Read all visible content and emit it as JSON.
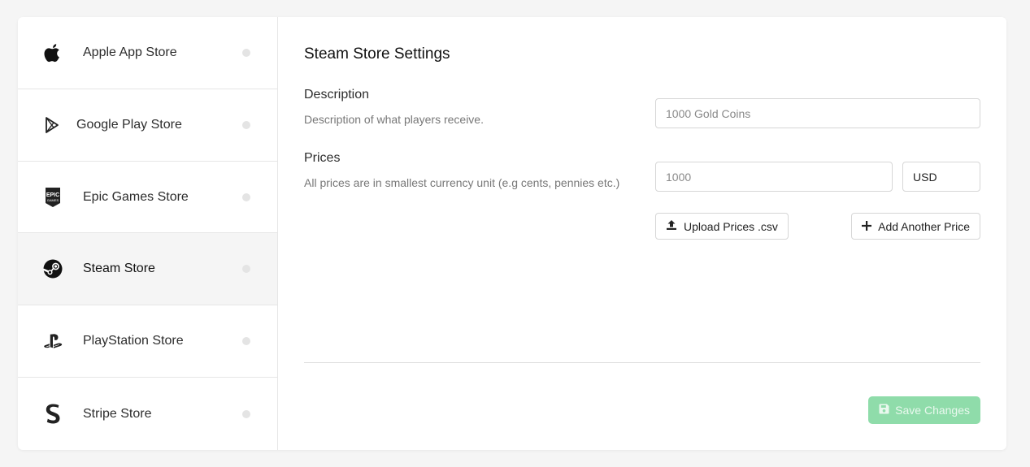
{
  "sidebar": {
    "items": [
      {
        "label": "Apple App Store",
        "icon": "apple-icon"
      },
      {
        "label": "Google Play Store",
        "icon": "google-play-icon"
      },
      {
        "label": "Epic Games Store",
        "icon": "epic-games-icon"
      },
      {
        "label": "Steam Store",
        "icon": "steam-icon",
        "active": true
      },
      {
        "label": "PlayStation Store",
        "icon": "playstation-icon"
      },
      {
        "label": "Stripe Store",
        "icon": "stripe-icon"
      }
    ]
  },
  "main": {
    "title": "Steam Store Settings",
    "description": {
      "title": "Description",
      "help": "Description of what players receive.",
      "placeholder": "1000 Gold Coins"
    },
    "prices": {
      "title": "Prices",
      "help": "All prices are in smallest currency unit (e.g cents, pennies etc.)",
      "amount_placeholder": "1000",
      "currency": "USD",
      "upload_label": "Upload Prices .csv",
      "add_label": "Add Another Price"
    },
    "save_label": "Save Changes"
  },
  "colors": {
    "accent": "#8fdcaa",
    "active_bg": "#f5f5f5"
  }
}
